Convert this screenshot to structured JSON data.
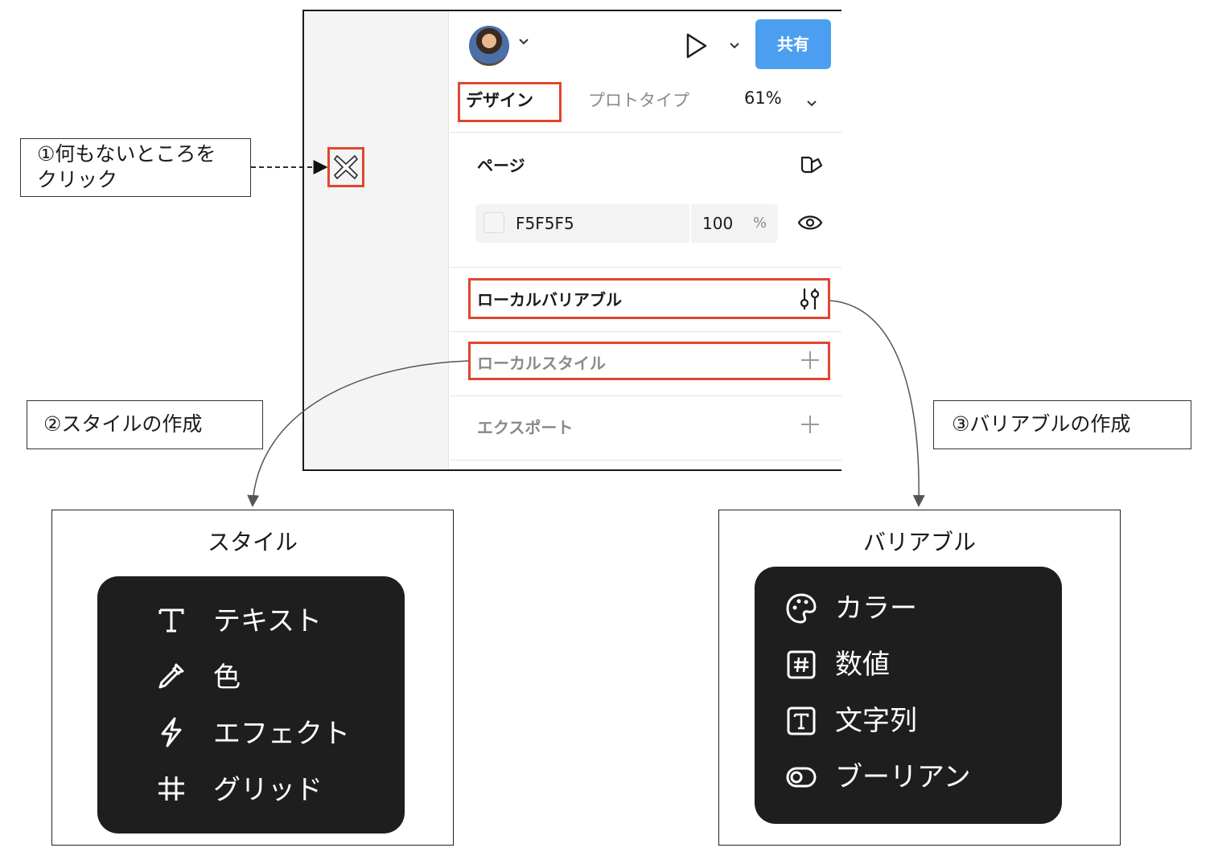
{
  "toolbar": {
    "share_label": "共有"
  },
  "tabs": {
    "design": "デザイン",
    "prototype": "プロトタイプ",
    "zoom": "61%"
  },
  "page_section": {
    "title": "ページ",
    "color_hex": "F5F5F5",
    "opacity": "100",
    "opacity_unit": "%"
  },
  "local_variables": {
    "title": "ローカルバリアブル"
  },
  "local_styles": {
    "title": "ローカルスタイル"
  },
  "export": {
    "title": "エクスポート"
  },
  "callouts": {
    "step1": "①何もないところを",
    "step1_line2": "クリック",
    "step2": "②スタイルの作成",
    "step3": "③バリアブルの作成"
  },
  "styles_menu": {
    "title": "スタイル",
    "items": [
      {
        "label": "テキスト",
        "icon": "text-icon"
      },
      {
        "label": "色",
        "icon": "eyedropper-icon"
      },
      {
        "label": "エフェクト",
        "icon": "lightning-icon"
      },
      {
        "label": "グリッド",
        "icon": "grid-icon"
      }
    ]
  },
  "variables_menu": {
    "title": "バリアブル",
    "items": [
      {
        "label": "カラー",
        "icon": "palette-icon"
      },
      {
        "label": "数値",
        "icon": "hash-icon"
      },
      {
        "label": "文字列",
        "icon": "text-box-icon"
      },
      {
        "label": "ブーリアン",
        "icon": "toggle-icon"
      }
    ]
  },
  "colors": {
    "highlight": "#e0462f",
    "share_button": "#4c9ff0",
    "menu_bg": "#1e1e1e"
  }
}
